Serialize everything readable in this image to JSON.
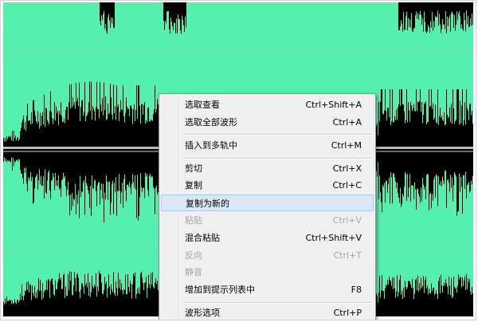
{
  "colors": {
    "waveform_background": "#55f0ad",
    "waveform": "#000000",
    "menu_background": "#f0f0f0",
    "menu_highlight": "#dbe7f7",
    "menu_disabled_text": "#a6a6a6"
  },
  "context_menu": {
    "items": [
      {
        "label": "选取查看",
        "shortcut": "Ctrl+Shift+A",
        "enabled": true
      },
      {
        "label": "选取全部波形",
        "shortcut": "Ctrl+A",
        "enabled": true
      },
      {
        "label": "插入到多轨中",
        "shortcut": "Ctrl+M",
        "enabled": true
      },
      {
        "label": "剪切",
        "shortcut": "Ctrl+X",
        "enabled": true
      },
      {
        "label": "复制",
        "shortcut": "Ctrl+C",
        "enabled": true
      },
      {
        "label": "复制为新的",
        "shortcut": "",
        "enabled": true,
        "highlighted": true
      },
      {
        "label": "粘贴",
        "shortcut": "Ctrl+V",
        "enabled": false
      },
      {
        "label": "混合粘贴",
        "shortcut": "Ctrl+Shift+V",
        "enabled": true
      },
      {
        "label": "反向",
        "shortcut": "Ctrl+T",
        "enabled": false
      },
      {
        "label": "静音",
        "shortcut": "",
        "enabled": false
      },
      {
        "label": "增加到提示列表中",
        "shortcut": "F8",
        "enabled": true
      },
      {
        "label": "波形选项",
        "shortcut": "Ctrl+P",
        "enabled": true
      }
    ]
  }
}
